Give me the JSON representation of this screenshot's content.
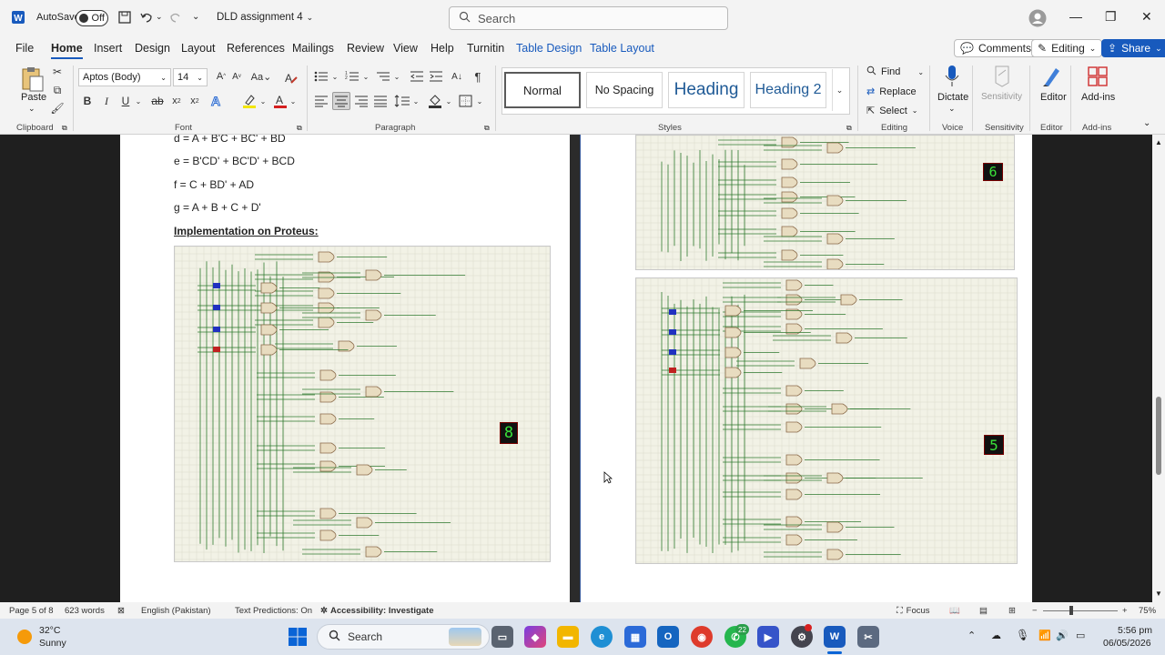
{
  "titlebar": {
    "autosave_label": "AutoSave",
    "autosave_state": "Off",
    "doc_title": "DLD assignment 4",
    "search_placeholder": "Search"
  },
  "menu": {
    "items": [
      "File",
      "Home",
      "Insert",
      "Design",
      "Layout",
      "References",
      "Mailings",
      "Review",
      "View",
      "Help",
      "Turnitin",
      "Table Design",
      "Table Layout"
    ],
    "comments_label": "Comments",
    "editing_label": "Editing",
    "share_label": "Share"
  },
  "ribbon": {
    "paste_label": "Paste",
    "font_name": "Aptos (Body)",
    "font_size": "14",
    "styles": [
      "Normal",
      "No Spacing",
      "Heading",
      "Heading 2"
    ],
    "find_label": "Find",
    "replace_label": "Replace",
    "select_label": "Select",
    "dictate_label": "Dictate",
    "sensitivity_label": "Sensitivity",
    "editor_label": "Editor",
    "addins_label": "Add-ins",
    "groups": {
      "clipboard": "Clipboard",
      "font": "Font",
      "paragraph": "Paragraph",
      "styles": "Styles",
      "editing": "Editing",
      "voice": "Voice",
      "sensitivity": "Sensitivity",
      "editor": "Editor",
      "addins": "Add-ins"
    }
  },
  "document": {
    "equations": [
      "d = A + B'C + BC' + BD",
      "e = B'CD' + BC'D' + BCD",
      "f = C + BD' + AD",
      "g = A + B + C + D'"
    ],
    "heading": "Implementation on Proteus:",
    "display_left": "8",
    "display_right_top": "6",
    "display_right_bottom": "5"
  },
  "status": {
    "page": "Page 5 of 8",
    "words": "623 words",
    "language": "English (Pakistan)",
    "predictions": "Text Predictions: On",
    "accessibility": "Accessibility: Investigate",
    "focus": "Focus",
    "zoom": "75%"
  },
  "taskbar": {
    "temp": "32°C",
    "weather": "Sunny",
    "search_label": "Search",
    "whatsapp_badge": "22",
    "time": "5:56 pm",
    "date": "06/05/2026"
  },
  "colors": {
    "word_blue": "#185abd",
    "wire_green": "#2f7a2f",
    "circuit_bg": "#f2f2e6"
  }
}
